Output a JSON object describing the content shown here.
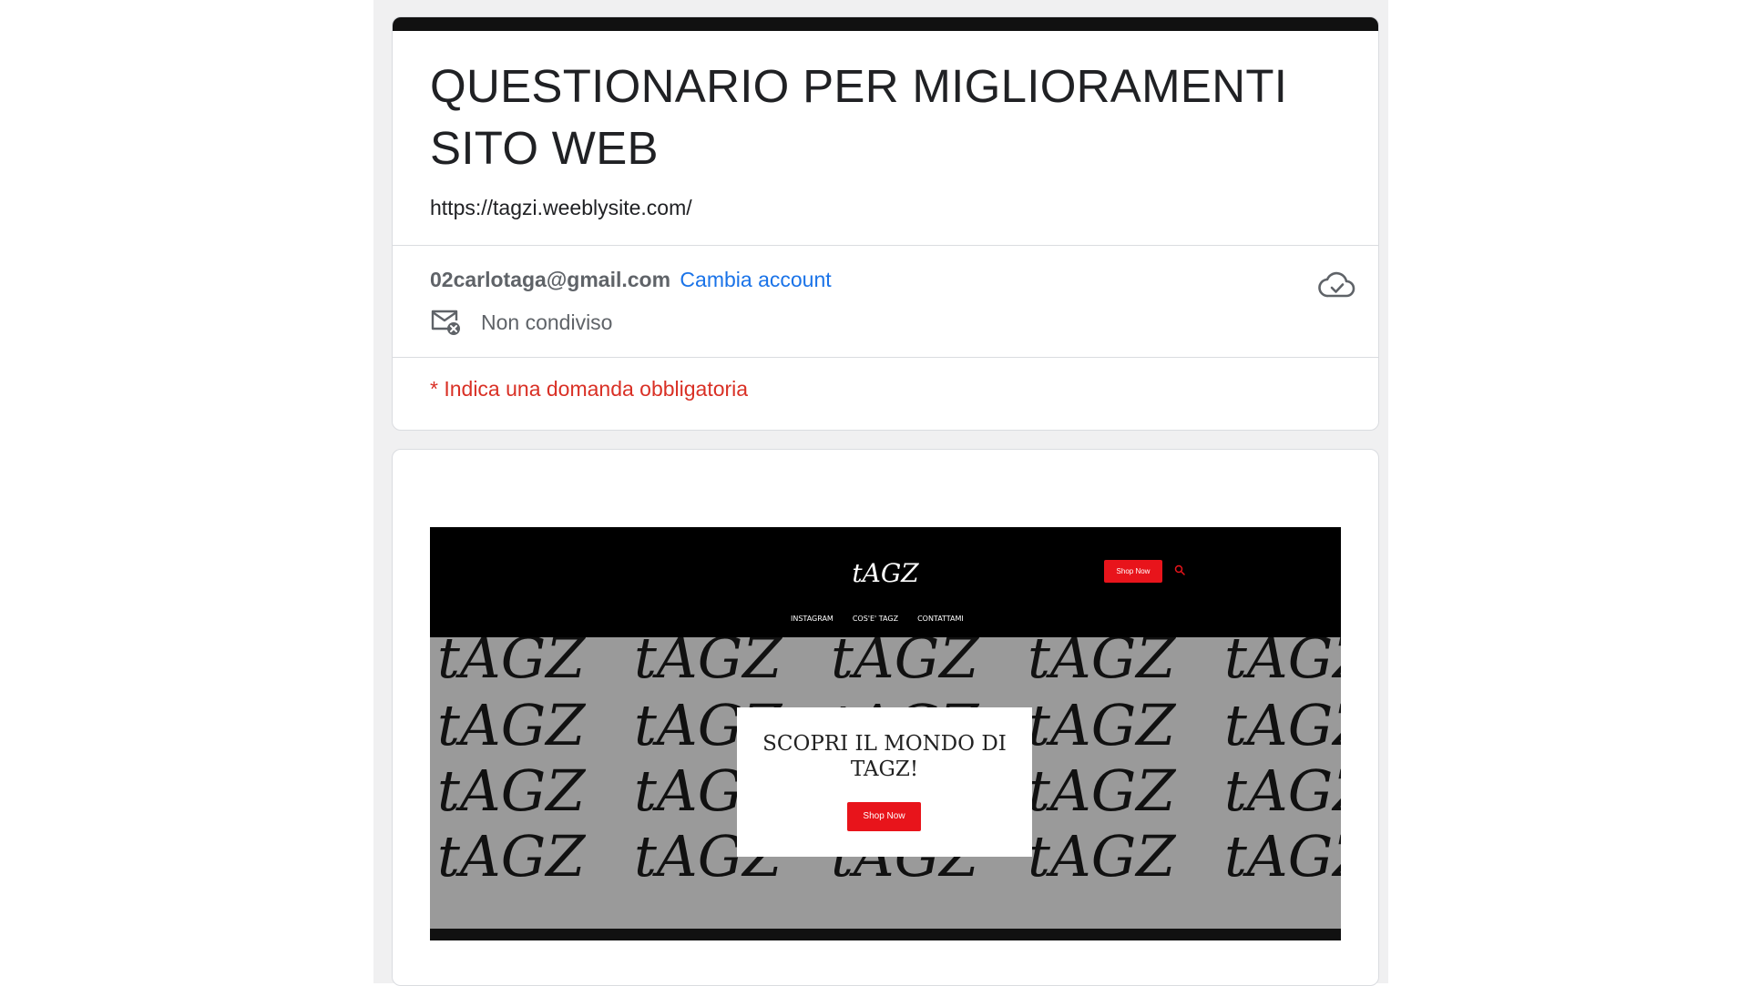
{
  "form": {
    "title": "QUESTIONARIO PER MIGLIORAMENTI SITO WEB",
    "description": "https://tagzi.weeblysite.com/"
  },
  "account": {
    "email": "02carlotaga@gmail.com",
    "switch_label": "Cambia account",
    "share_status": "Non condiviso"
  },
  "required_note": "* Indica una domanda obbligatoria",
  "embedded_site": {
    "logo_text": "tAGZ",
    "shop_button": "Shop Now",
    "nav": [
      "INSTAGRAM",
      "COS'E' TAGZ",
      "CONTATTAMI"
    ],
    "pattern_text": "tAGZ",
    "promo_title": "SCOPRI IL MONDO DI TAGZ!",
    "promo_button": "Shop Now"
  },
  "colors": {
    "accent_link": "#1a73e8",
    "required": "#d93025",
    "header_bar": "#111111",
    "shop_red": "#e8141b"
  },
  "icons": {
    "cloud": "cloud-check-icon",
    "mail": "mail-off-icon",
    "search": "search-icon"
  }
}
